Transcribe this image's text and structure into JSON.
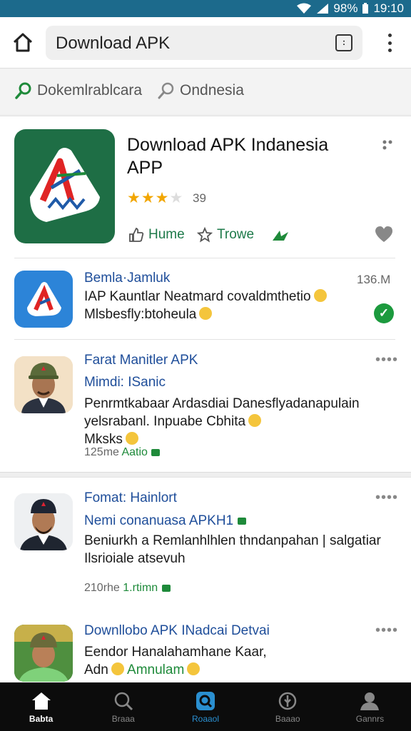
{
  "status_bar": {
    "battery": "98%",
    "time": "19:10"
  },
  "toolbar": {
    "search_text": "Download APK"
  },
  "chips": [
    {
      "label": "Dokemlrablcara"
    },
    {
      "label": "Ondnesia"
    }
  ],
  "featured": {
    "title_line1": "Download APK Indanesia",
    "title_line2": "APP",
    "rating_value": 3.5,
    "rating_count": "39",
    "actions": {
      "like": "Hume",
      "star": "Trowe"
    }
  },
  "items": [
    {
      "title": "Bemla·Jamluk",
      "size": "136.M",
      "line1": "IAP Kauntlar Neatmard covaldmthetio",
      "line2": "Mlsbesfly:btoheula"
    },
    {
      "title": "Farat Manitler APK",
      "subtitle": "Mimdi: ISanic",
      "line1": "Penrmtkabaar Ardasdiai Danesflyadanapulain",
      "line2": "yelsrabanl. Inpuabe Cbhita",
      "line3": "Mksks",
      "meta_time": "125me",
      "meta_tag": "Aatio"
    },
    {
      "title": "Fomat: Hainlort",
      "subtitle": "Nemi conanuasa APKH1",
      "line1": "Beniurkh a Remlanhlhlen thndanpahan | salgatiar",
      "line2": "Ilsrioiale atsevuh",
      "meta_time": "210rhe",
      "meta_tag": "1.rtimn"
    },
    {
      "title": "Downllobo APK INadcai Detvai",
      "line1": "Eendor Hanalahamhane Kaar,",
      "line2a": "Adn",
      "line2b": "Amnulam"
    }
  ],
  "bottom_nav": [
    {
      "label": "Babta",
      "icon": "home-icon"
    },
    {
      "label": "Braaa",
      "icon": "search-icon"
    },
    {
      "label": "Roaaol",
      "icon": "search-active-icon"
    },
    {
      "label": "Baaao",
      "icon": "compass-icon"
    },
    {
      "label": "Gannrs",
      "icon": "profile-icon"
    }
  ],
  "colors": {
    "status_bar": "#1c6a8c",
    "brand_green": "#1e6e45",
    "link_blue": "#1f4e9a",
    "accent_green": "#1e8a3a",
    "nav_active_blue": "#2a8fd0"
  }
}
